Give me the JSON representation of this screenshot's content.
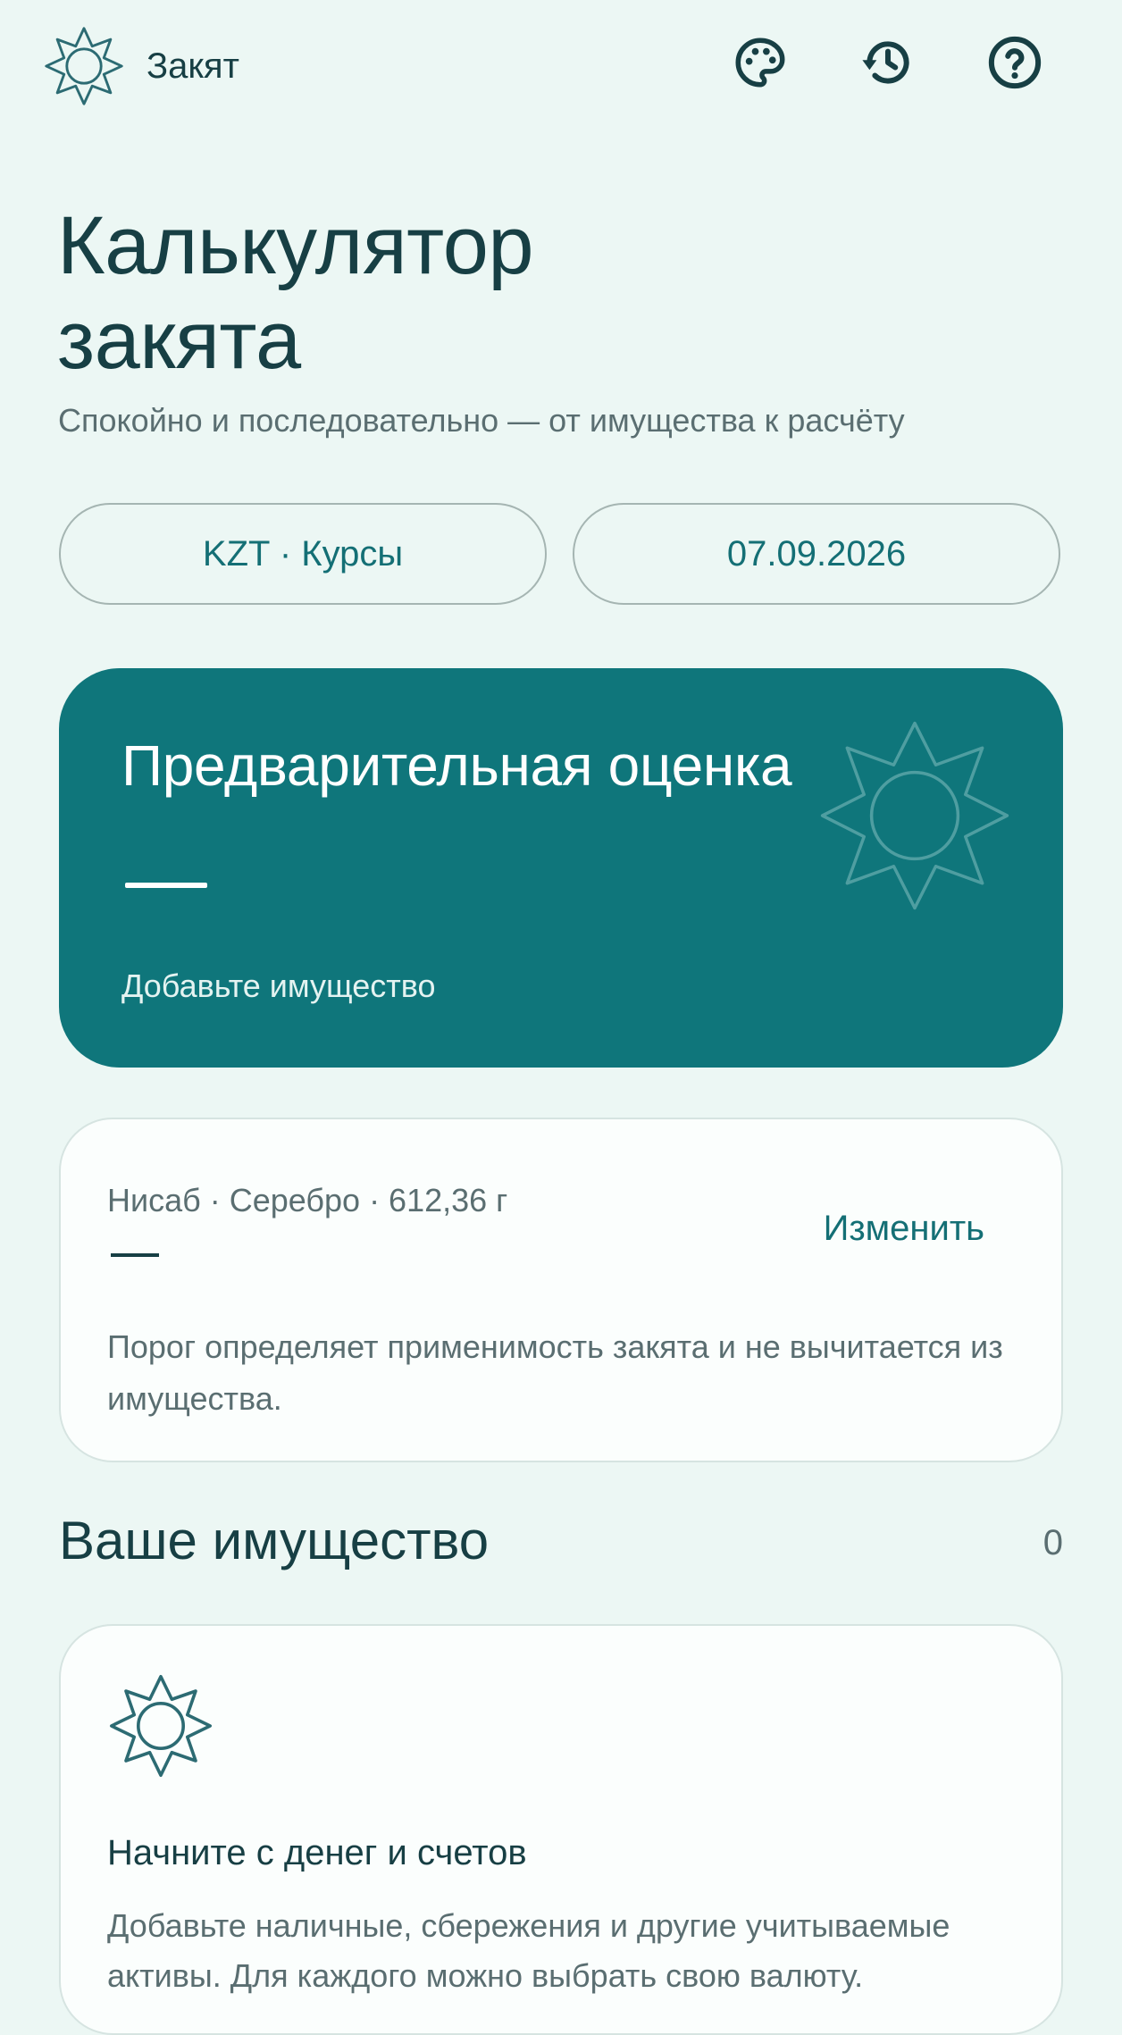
{
  "header": {
    "app_name": "Закят",
    "icons": [
      "sun-logo-icon",
      "palette-icon",
      "history-icon",
      "help-icon"
    ]
  },
  "page": {
    "title": "Калькулятор закята",
    "subtitle": "Спокойно и последовательно — от имущества к расчёту"
  },
  "controls": {
    "currency_label": "KZT · Курсы",
    "date_label": "07.09.2026"
  },
  "estimate": {
    "title": "Предварительная оценка",
    "value": "—",
    "hint": "Добавьте имущество"
  },
  "nisab": {
    "label": "Нисаб · Серебро · 612,36 г",
    "value": "—",
    "change_label": "Изменить",
    "note": "Порог определяет применимость закята и не вычитается из имущества."
  },
  "assets": {
    "title": "Ваше имущество",
    "count": "0",
    "empty_title": "Начните с денег и счетов",
    "empty_text": "Добавьте наличные, сбережения и другие учитываемые активы. Для каждого можно выбрать свою валюту."
  },
  "colors": {
    "background": "#ecf7f4",
    "primary": "#0f767b",
    "text_dark": "#173f44",
    "text_muted": "#5a6e71",
    "card": "#fbfefd"
  }
}
